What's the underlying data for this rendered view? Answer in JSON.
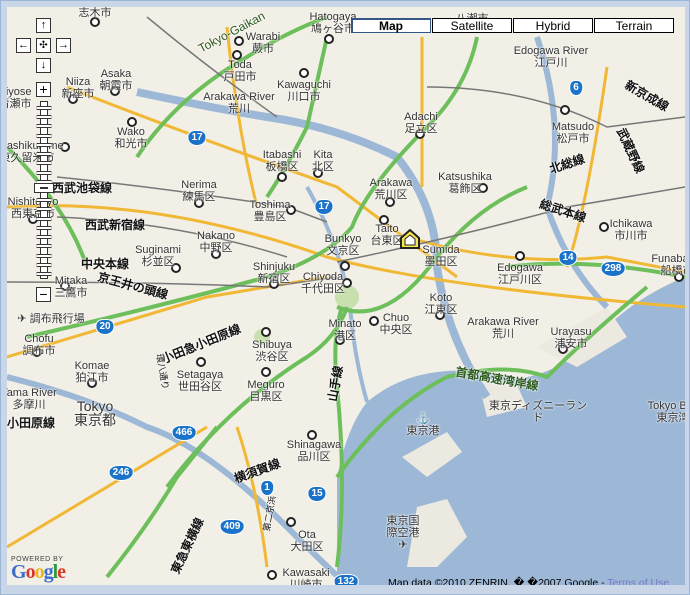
{
  "map_types": [
    {
      "label": "Map",
      "active": true
    },
    {
      "label": "Satellite",
      "active": false
    },
    {
      "label": "Hybrid",
      "active": false
    },
    {
      "label": "Terrain",
      "active": false
    }
  ],
  "pan_controls": {
    "up": "↑",
    "left": "←",
    "center": "✣",
    "right": "→",
    "down": "↓"
  },
  "zoom_controls": {
    "zoom_in": "+",
    "zoom_out": "−",
    "level_fraction_from_top": 0.49
  },
  "places": [
    {
      "en": "",
      "jp": "志木市"
    },
    {
      "en": "Asaka",
      "jp": "朝霞市"
    },
    {
      "en": "Niiza",
      "jp": "新座市"
    },
    {
      "en": "Kiyose",
      "jp": "清瀬市"
    },
    {
      "en": "Wako",
      "jp": "和光市"
    },
    {
      "en": "Higashikurume",
      "jp": "東久留米市"
    },
    {
      "en": "Nishitokyo",
      "jp": "西東京市"
    },
    {
      "en": "Mitaka",
      "jp": "三鷹市"
    },
    {
      "en": "Chofu",
      "jp": "調布市"
    },
    {
      "en": "Komae",
      "jp": "狛江市"
    },
    {
      "en": "Tokyo",
      "jp": "東京都"
    },
    {
      "en": "Tama River",
      "jp": "多摩川"
    },
    {
      "en": "Warabi",
      "jp": "蕨市"
    },
    {
      "en": "Toda",
      "jp": "戸田市"
    },
    {
      "en": "Hatogaya",
      "jp": "鳩ヶ谷市"
    },
    {
      "en": "Kawaguchi",
      "jp": "川口市"
    },
    {
      "en": "Arakawa River",
      "jp": "荒川"
    },
    {
      "en": "Itabashi",
      "jp": "板橋区"
    },
    {
      "en": "Kita",
      "jp": "北区"
    },
    {
      "en": "Nerima",
      "jp": "練馬区"
    },
    {
      "en": "Toshima",
      "jp": "豊島区"
    },
    {
      "en": "Nakano",
      "jp": "中野区"
    },
    {
      "en": "Suginami",
      "jp": "杉並区"
    },
    {
      "en": "Shinjuku",
      "jp": "新宿区"
    },
    {
      "en": "Bunkyo",
      "jp": "文京区"
    },
    {
      "en": "Chiyoda",
      "jp": "千代田区"
    },
    {
      "en": "Arakawa",
      "jp": "荒川区"
    },
    {
      "en": "Taito",
      "jp": "台東区"
    },
    {
      "en": "Sumida",
      "jp": "墨田区"
    },
    {
      "en": "Adachi",
      "jp": "足立区"
    },
    {
      "en": "Katsushika",
      "jp": "葛飾区"
    },
    {
      "en": "Edogawa River",
      "jp": "江戸川"
    },
    {
      "en": "Matsudo",
      "jp": "松戸市"
    },
    {
      "en": "Edogawa",
      "jp": "江戸川区"
    },
    {
      "en": "Ichikawa",
      "jp": "市川市"
    },
    {
      "en": "Funabashi",
      "jp": "船橋市"
    },
    {
      "en": "Minato",
      "jp": "港区"
    },
    {
      "en": "Chuo",
      "jp": "中央区"
    },
    {
      "en": "Koto",
      "jp": "江東区"
    },
    {
      "en": "Arakawa River",
      "jp": "荒川"
    },
    {
      "en": "Urayasu",
      "jp": "浦安市"
    },
    {
      "en": "Shibuya",
      "jp": "渋谷区"
    },
    {
      "en": "Setagaya",
      "jp": "世田谷区"
    },
    {
      "en": "Meguro",
      "jp": "目黒区"
    },
    {
      "en": "Shinagawa",
      "jp": "品川区"
    },
    {
      "en": "Ota",
      "jp": "大田区"
    },
    {
      "en": "Kawasaki",
      "jp": "川崎市"
    },
    {
      "en": "Tokyo Bay",
      "jp": "東京湾"
    },
    {
      "en": "",
      "jp": "東京港"
    },
    {
      "en": "",
      "jp": "東京ディズニーランド"
    },
    {
      "en": "",
      "jp": "東京国際空港"
    },
    {
      "en": "",
      "jp": "調布飛行場"
    },
    {
      "en": "",
      "jp": "八潮市"
    }
  ],
  "rail_lines": [
    {
      "label": "西武池袋線"
    },
    {
      "label": "西武新宿線"
    },
    {
      "label": "中央本線"
    },
    {
      "label": "京王井の頭線"
    },
    {
      "label": "小田急小田原線"
    },
    {
      "label": "小田原線"
    },
    {
      "label": "山手線"
    },
    {
      "label": "横須賀線"
    },
    {
      "label": "東急東横線"
    },
    {
      "label": "総武本線"
    },
    {
      "label": "北総線"
    },
    {
      "label": "武蔵野線"
    },
    {
      "label": "新京成線"
    },
    {
      "label": "首都高速湾岸線"
    },
    {
      "label": "Tokyo-Gaikan"
    },
    {
      "label": "環八通り"
    },
    {
      "label": "第二京浜"
    }
  ],
  "route_shields": [
    "17",
    "17",
    "6",
    "20",
    "14",
    "298",
    "466",
    "246",
    "1",
    "15",
    "409",
    "132"
  ],
  "marker": {
    "name": "house-marker",
    "near": "Sumida"
  },
  "attribution": {
    "powered_by": "POWERED BY",
    "logo": "Google",
    "copyright": "Map data ©2010 ZENRIN, � �2007 Google - ",
    "terms_link": "Terms of Use"
  },
  "colors": {
    "land": "#f2efe6",
    "water": "#9db8d6",
    "expressway": "#6cbf5a",
    "major_road": "#f0b834",
    "shield": "#1a73c8"
  }
}
